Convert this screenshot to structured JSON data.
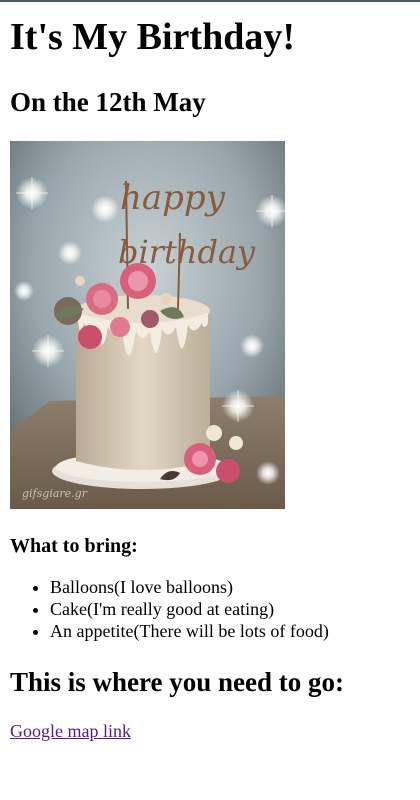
{
  "page": {
    "title": "It's My Birthday!",
    "date_heading": "On the 12th May",
    "bring_heading": "What to bring:",
    "bring_items": [
      "Balloons(I love balloons)",
      "Cake(I'm really good at eating)",
      "An appetite(There will be lots of food)"
    ],
    "where_heading": "This is where you need to go:",
    "map_link_label": "Google map link"
  },
  "image": {
    "topper_line1": "happy",
    "topper_line2": "birthday",
    "watermark": "gifsgiare.gr"
  },
  "colors": {
    "link_visited": "#551a8b",
    "image_background": "#8a9aa0",
    "cake": "#d9ccb8",
    "roses": "#d8607a",
    "topper": "#8a5a3a"
  }
}
